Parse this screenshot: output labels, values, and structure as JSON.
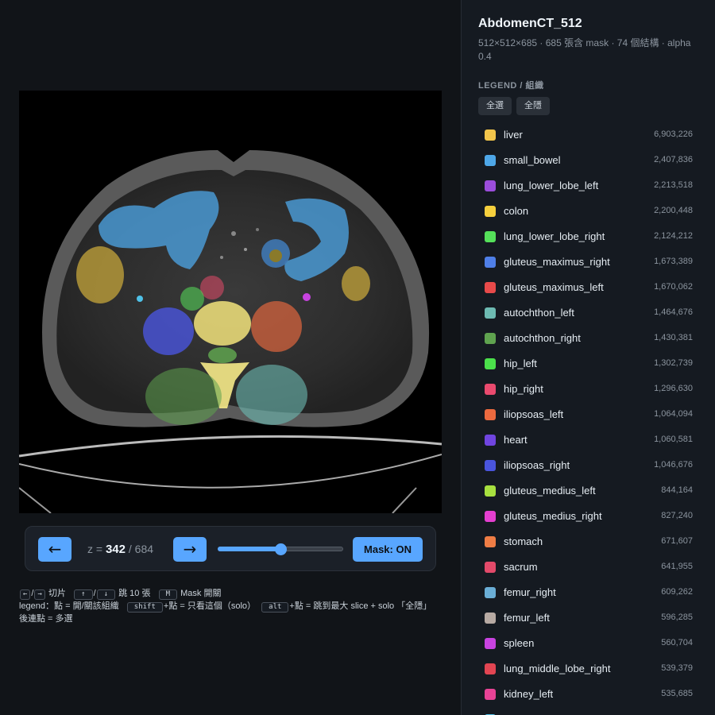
{
  "viewer": {
    "z_prefix": "z =",
    "z_current": "342",
    "z_separator": "/",
    "z_max": "684",
    "slider_fraction": 0.5,
    "prev_label": "←",
    "next_label": "→",
    "mask_label": "Mask: ON"
  },
  "help": {
    "line1": {
      "k_left": "←",
      "slash": "/",
      "k_right": "→",
      "t1": "切片",
      "k_up": "↑",
      "k_down": "↓",
      "t2": "跳 10 張",
      "k_m": "M",
      "t3": "Mask 開關"
    },
    "line2": {
      "t1": "legend：點 = 開/關該組織",
      "k_shift": "shift",
      "t2": "+點 = 只看這個（solo）",
      "k_alt": "alt",
      "t3": "+點 = 跳到最大 slice + solo 「全隱」"
    },
    "line3": "後連點 = 多選"
  },
  "panel": {
    "title": "AbdomenCT_512",
    "meta": "512×512×685 · 685 張含 mask · 74 個結構 · alpha 0.4",
    "legend_heading": "LEGEND / 組織",
    "select_all": "全選",
    "hide_all": "全隱"
  },
  "legend": [
    {
      "name": "liver",
      "count": "6,903,226",
      "color": "#f2c54b"
    },
    {
      "name": "small_bowel",
      "count": "2,407,836",
      "color": "#4ea7e8"
    },
    {
      "name": "lung_lower_lobe_left",
      "count": "2,213,518",
      "color": "#9b4ddb"
    },
    {
      "name": "colon",
      "count": "2,200,448",
      "color": "#f5cf3d"
    },
    {
      "name": "lung_lower_lobe_right",
      "count": "2,124,212",
      "color": "#55e05a"
    },
    {
      "name": "gluteus_maximus_right",
      "count": "1,673,389",
      "color": "#4f7fe8"
    },
    {
      "name": "gluteus_maximus_left",
      "count": "1,670,062",
      "color": "#e84a4a"
    },
    {
      "name": "autochthon_left",
      "count": "1,464,676",
      "color": "#6dbab2"
    },
    {
      "name": "autochthon_right",
      "count": "1,430,381",
      "color": "#5fa34f"
    },
    {
      "name": "hip_left",
      "count": "1,302,739",
      "color": "#4be04b"
    },
    {
      "name": "hip_right",
      "count": "1,296,630",
      "color": "#ea4a6e"
    },
    {
      "name": "iliopsoas_left",
      "count": "1,064,094",
      "color": "#ec6a3f"
    },
    {
      "name": "heart",
      "count": "1,060,581",
      "color": "#7045e0"
    },
    {
      "name": "iliopsoas_right",
      "count": "1,046,676",
      "color": "#4a55dd"
    },
    {
      "name": "gluteus_medius_left",
      "count": "844,164",
      "color": "#a7e03f"
    },
    {
      "name": "gluteus_medius_right",
      "count": "827,240",
      "color": "#e43fd0"
    },
    {
      "name": "stomach",
      "count": "671,607",
      "color": "#ef7d45"
    },
    {
      "name": "sacrum",
      "count": "641,955",
      "color": "#e34a6a"
    },
    {
      "name": "femur_right",
      "count": "609,262",
      "color": "#6aaed6"
    },
    {
      "name": "femur_left",
      "count": "596,285",
      "color": "#b7aaa3"
    },
    {
      "name": "spleen",
      "count": "560,704",
      "color": "#c843e0"
    },
    {
      "name": "lung_middle_lobe_right",
      "count": "539,379",
      "color": "#e24552"
    },
    {
      "name": "kidney_left",
      "count": "535,685",
      "color": "#e84396"
    },
    {
      "name": "",
      "count": "",
      "color": "#4fc1e8"
    }
  ]
}
